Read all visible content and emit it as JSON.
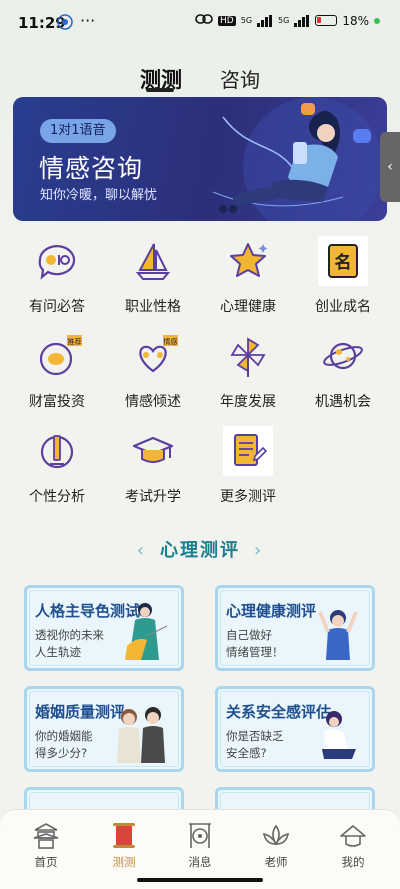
{
  "status": {
    "time": "11:29",
    "battery": "18%",
    "net1": "5G",
    "net2": "5G",
    "hd": "HD"
  },
  "tabs": [
    {
      "label": "测测",
      "active": true
    },
    {
      "label": "咨询",
      "active": false
    }
  ],
  "banner": {
    "pill": "1对1语音",
    "title": "情感咨询",
    "subtitle": "知你冷暖，聊以解忧"
  },
  "grid": [
    {
      "label": "有问必答",
      "icon": "speech-bubble-icon"
    },
    {
      "label": "职业性格",
      "icon": "sailboat-icon"
    },
    {
      "label": "心理健康",
      "icon": "star-icon"
    },
    {
      "label": "创业成名",
      "icon": "name-tag-icon",
      "icon_text": "名"
    },
    {
      "label": "财富投资",
      "icon": "money-bag-icon",
      "badge": "推荐"
    },
    {
      "label": "情感倾述",
      "icon": "heart-people-icon",
      "badge": "情感"
    },
    {
      "label": "年度发展",
      "icon": "pinwheel-icon"
    },
    {
      "label": "机遇机会",
      "icon": "planet-icon"
    },
    {
      "label": "个性分析",
      "icon": "pencil-circle-icon"
    },
    {
      "label": "考试升学",
      "icon": "graduation-cap-icon"
    },
    {
      "label": "更多测评",
      "icon": "notepad-icon"
    }
  ],
  "section": {
    "title": "心理测评"
  },
  "cards": [
    {
      "title": "人格主导色测试",
      "desc": "透视你的未来\n人生轨迹"
    },
    {
      "title": "心理健康测评",
      "desc": "自己做好\n情绪管理！"
    },
    {
      "title": "婚姻质量测评",
      "desc": "你的婚姻能\n得多少分?"
    },
    {
      "title": "关系安全感评估",
      "desc": "你是否缺乏\n安全感?"
    }
  ],
  "nav": [
    {
      "label": "首页",
      "active": false,
      "icon": "temple-icon"
    },
    {
      "label": "测测",
      "active": true,
      "icon": "scroll-icon"
    },
    {
      "label": "消息",
      "active": false,
      "icon": "gong-icon"
    },
    {
      "label": "老师",
      "active": false,
      "icon": "lotus-icon"
    },
    {
      "label": "我的",
      "active": false,
      "icon": "hat-icon"
    }
  ],
  "colors": {
    "accent": "#1a7f8e",
    "icon_purple": "#5a3fa0",
    "icon_gold": "#f2b632",
    "nav_active": "#c08a3a"
  }
}
